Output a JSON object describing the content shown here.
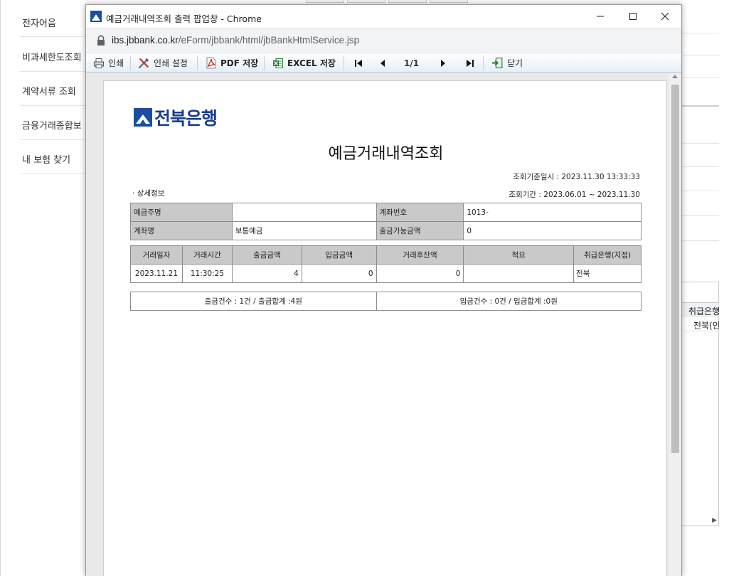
{
  "background": {
    "sidebar_items": [
      "전자어음",
      "비과세한도조회",
      "계약서류 조회",
      "금융거래종합보",
      "내 보험 찾기"
    ],
    "right_panel": {
      "header": "취급은행",
      "cell": "전북(인"
    }
  },
  "window": {
    "title": "예금거래내역조회 출력 팝업창 - Chrome",
    "url_host": "ibs.jbbank.co.kr",
    "url_path": "/eForm/jbbank/html/jbBankHtmlService.jsp"
  },
  "toolbar": {
    "print": "인쇄",
    "print_settings": "인쇄 설정",
    "pdf_save": "PDF 저장",
    "excel_save": "EXCEL 저장",
    "page": "1/1",
    "close": "닫기"
  },
  "document": {
    "bank_name": "전북은행",
    "title": "예금거래내역조회",
    "query_datetime": "조회기준일시 : 2023.11.30 13:33:33",
    "query_period": "조회기간 :  2023.06.01 ~ 2023.11.30",
    "section_label": "· 상세정보",
    "info": {
      "owner_label": "예금주명",
      "owner_value": "",
      "account_no_label": "계좌번호",
      "account_no_value": "1013-",
      "account_name_label": "계좌명",
      "account_name_value": "보통예금",
      "withdrawable_label": "출금가능금액",
      "withdrawable_value": "0"
    },
    "transactions": {
      "columns": [
        "거래일자",
        "거래시간",
        "출금금액",
        "입금금액",
        "거래후잔액",
        "적요",
        "취급은행(지점)"
      ],
      "rows": [
        {
          "date": "2023.11.21",
          "time": "11:30:25",
          "withdraw": "4",
          "deposit": "0",
          "balance": "0",
          "memo": "",
          "branch": "전북"
        }
      ]
    },
    "summary": {
      "withdraw": "출금건수 : 1건  /  출금합계 :4원",
      "deposit": "입금건수 : 0건  /  입금합계 :0원"
    }
  }
}
